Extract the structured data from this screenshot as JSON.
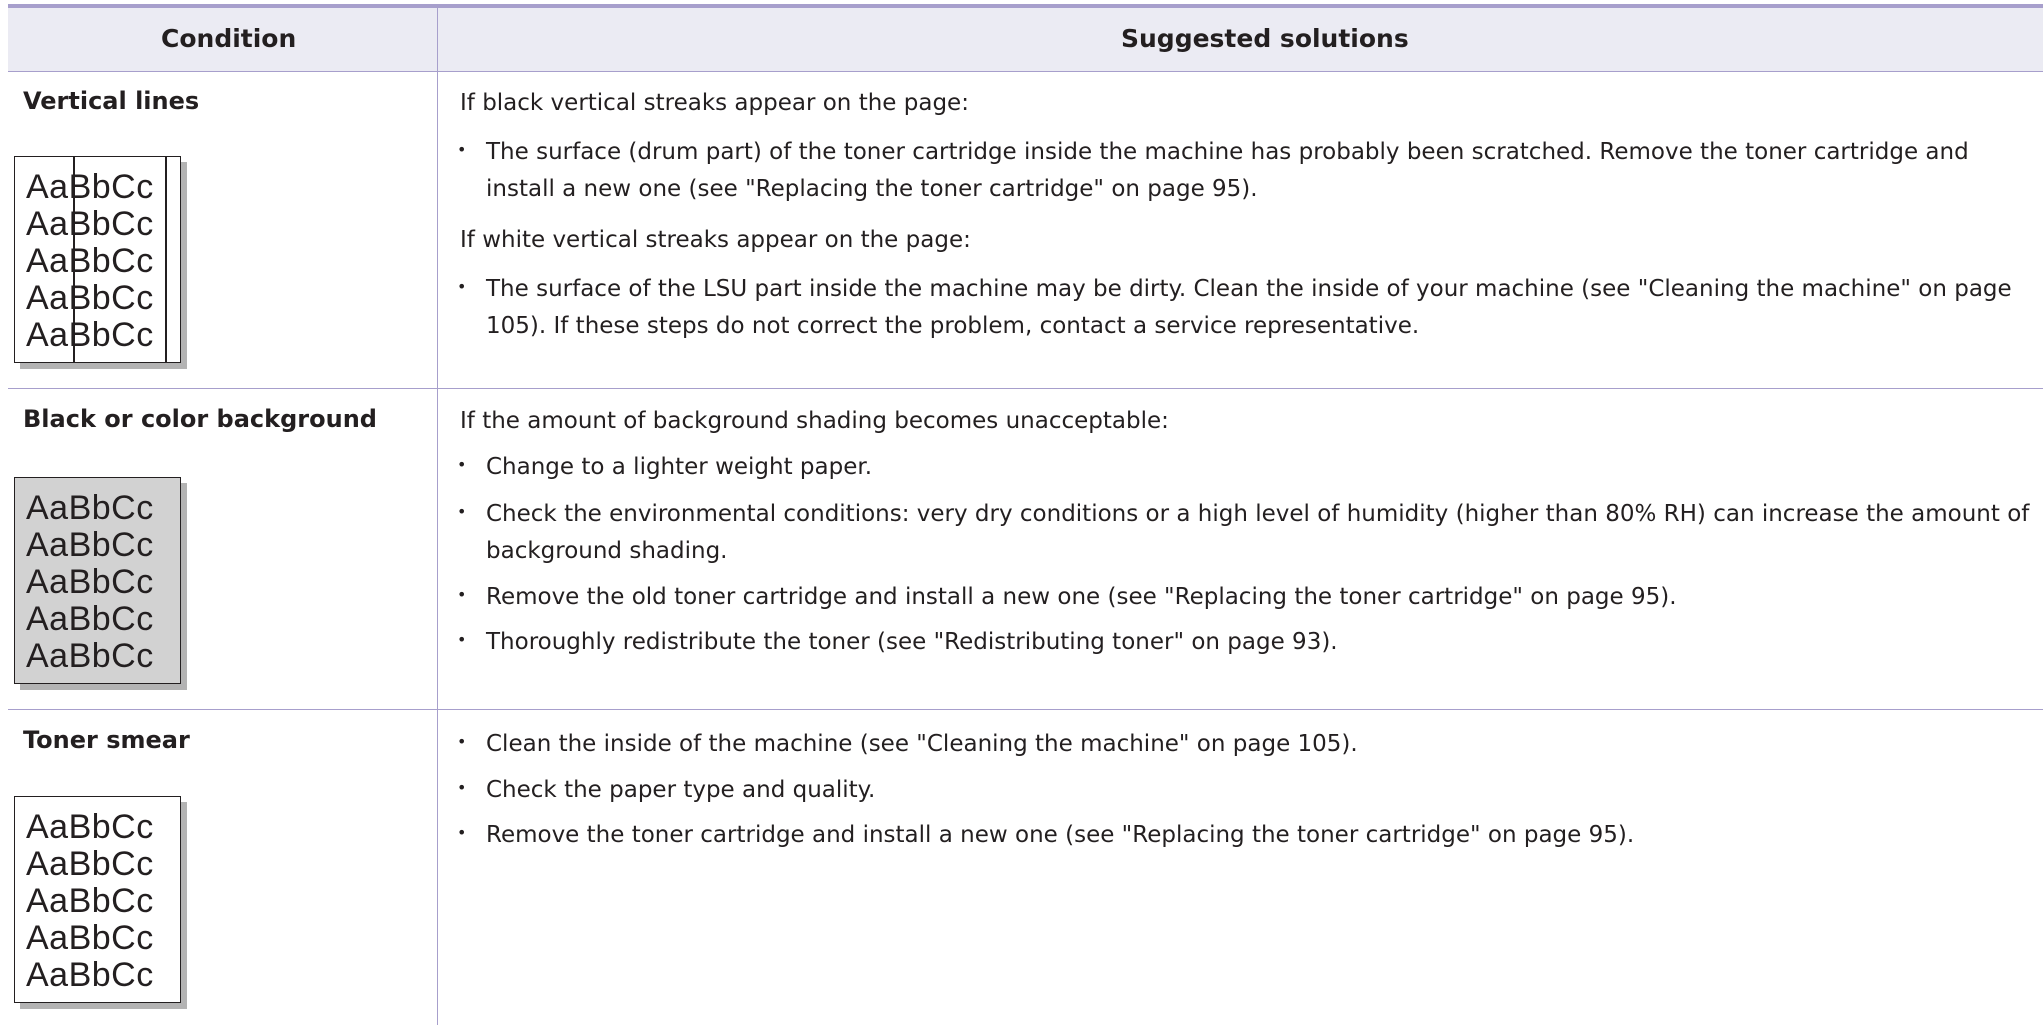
{
  "table": {
    "header": {
      "condition": "Condition",
      "solutions": "Suggested solutions"
    },
    "rows": [
      {
        "condition": "Vertical lines",
        "sample_text": "AaBbCc",
        "intro1": "If black vertical streaks appear on the page:",
        "bullets1": [
          "The surface (drum part) of the toner cartridge inside the machine has probably been scratched. Remove the toner cartridge and install a new one (see \"Replacing the toner cartridge\" on page 95)."
        ],
        "intro2": "If white vertical streaks appear on the page:",
        "bullets2": [
          "The surface of the LSU part inside the machine may be dirty. Clean the inside of your machine (see \"Cleaning the machine\" on page 105). If these steps do not correct the problem, contact a service representative."
        ]
      },
      {
        "condition": "Black or color background",
        "sample_text": "AaBbCc",
        "intro1": "If the amount of background shading becomes unacceptable:",
        "bullets1": [
          "Change to a lighter weight paper.",
          "Check the environmental conditions: very dry conditions or a high level of humidity (higher than 80% RH) can increase the amount of background shading.",
          "Remove the old toner cartridge and install a new one (see \"Replacing the toner cartridge\" on page 95).",
          "Thoroughly redistribute the toner (see \"Redistributing toner\" on page 93)."
        ]
      },
      {
        "condition": "Toner smear",
        "sample_text": "AaBbCc",
        "bullets1": [
          "Clean the inside of the machine (see \"Cleaning the machine\" on page 105).",
          "Check the paper type and quality.",
          "Remove the toner cartridge and install a new one (see \"Replacing the toner cartridge\" on page 95)."
        ]
      }
    ]
  },
  "colors": {
    "rule": "#a79fcc",
    "header_bg": "#ebebf3",
    "text": "#231f20",
    "shaded_paper": "#d2d2d2"
  }
}
